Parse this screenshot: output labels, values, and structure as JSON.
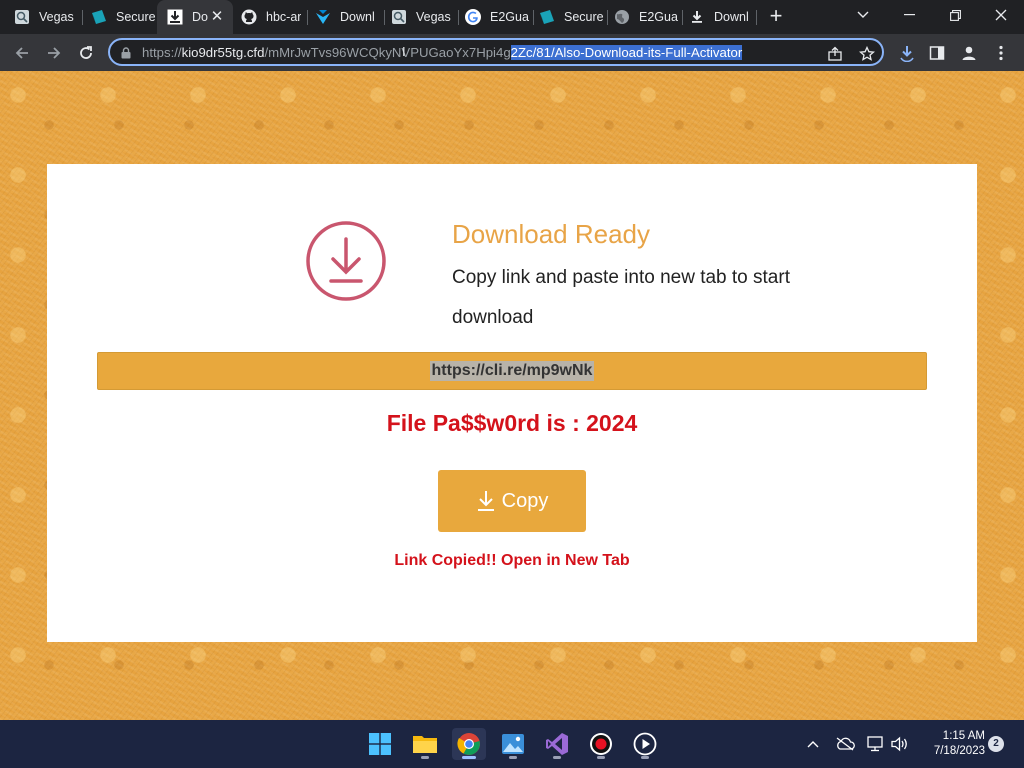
{
  "tabs": [
    {
      "title": "Vegas",
      "icon": "vegas-icon"
    },
    {
      "title": "Secure",
      "icon": "secure-icon"
    },
    {
      "title": "Do",
      "icon": "download-tab-icon",
      "active": true
    },
    {
      "title": "hbc-ar",
      "icon": "github-icon"
    },
    {
      "title": "Downl",
      "icon": "download-site-icon"
    },
    {
      "title": "Vegas",
      "icon": "vegas-icon"
    },
    {
      "title": "E2Gua",
      "icon": "google-icon"
    },
    {
      "title": "Secure",
      "icon": "secure-icon"
    },
    {
      "title": "E2Gua",
      "icon": "globe-icon"
    },
    {
      "title": "Downl",
      "icon": "download-arrow-icon"
    }
  ],
  "address_bar": {
    "scheme": "https://",
    "host": "kio9dr55tg.cfd",
    "path_plain": "/mMrJwTvs96WCQkyNVPUGaoYx7Hpi4g",
    "path_selected": "2Zc/81/Also-Download-its-Full-Activator"
  },
  "page": {
    "heading": "Download Ready",
    "subtext": "Copy link and paste into new tab to start download",
    "link": "https://cli.re/mp9wNk",
    "password_line": "File Pa$$w0rd is : 2024",
    "copy_button": "Copy",
    "copied_message": "Link Copied!! Open in New Tab"
  },
  "taskbar": {
    "time": "1:15 AM",
    "date": "7/18/2023",
    "notifications": "2"
  },
  "colors": {
    "accent": "#e8a83d",
    "heading": "#e8a447",
    "alert": "#d4121b",
    "circle": "#c9566e"
  }
}
